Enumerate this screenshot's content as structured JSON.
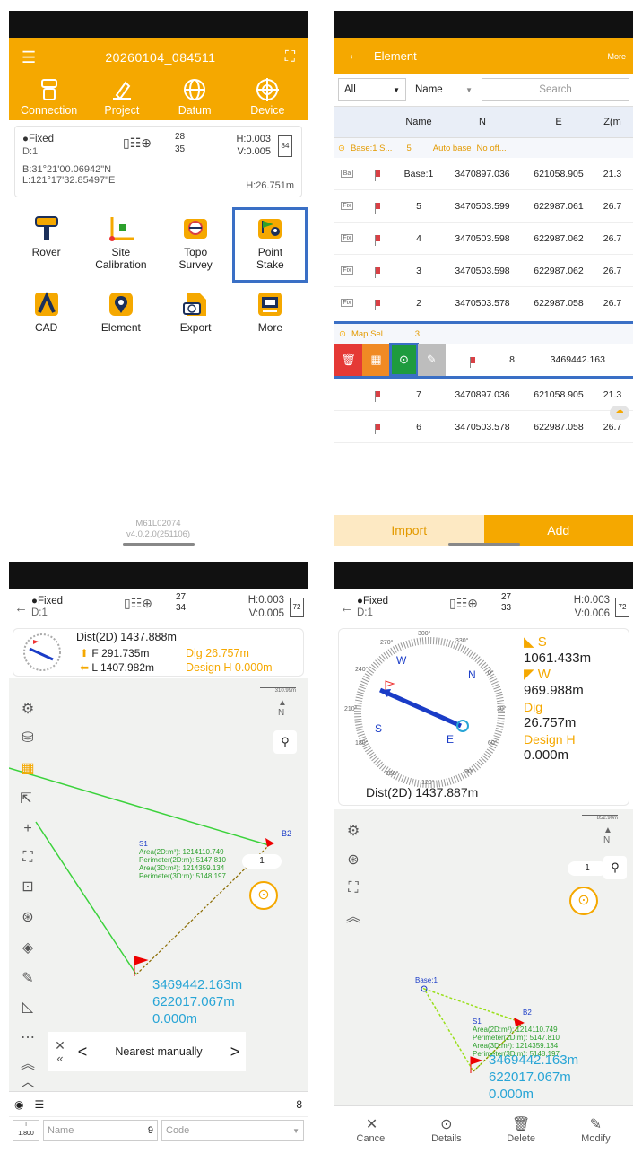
{
  "p1": {
    "title": "20260104_084511",
    "tabs": [
      "Connection",
      "Project",
      "Datum",
      "Device"
    ],
    "status": {
      "fix": "●Fixed",
      "d": "D:1",
      "sat_top": "28",
      "sat_bot": "35",
      "h": "H:0.003",
      "v": "V:0.005",
      "battery": "84",
      "b": "B:31°21'00.06942\"N",
      "l": "L:121°17'32.85497\"E",
      "height": "H:26.751m"
    },
    "tiles": [
      {
        "label": "Rover",
        "icon": "rover-icon"
      },
      {
        "label": "Site\nCalibration",
        "icon": "site-calibration-icon"
      },
      {
        "label": "Topo\nSurvey",
        "icon": "topo-survey-icon"
      },
      {
        "label": "Point\nStake",
        "icon": "point-stake-icon"
      },
      {
        "label": "CAD",
        "icon": "cad-icon"
      },
      {
        "label": "Element",
        "icon": "element-icon"
      },
      {
        "label": "Export",
        "icon": "export-icon"
      },
      {
        "label": "More",
        "icon": "more-icon"
      }
    ],
    "version1": "M61L02074",
    "version2": "v4.0.2.0(251106)"
  },
  "p2": {
    "title": "Element",
    "more": "More",
    "filter_all": "All",
    "filter_name": "Name",
    "search_placeholder": "Search",
    "headers": [
      "Name",
      "N",
      "E",
      "Z(m"
    ],
    "group1": {
      "label": "Base:1 S...",
      "count": "5",
      "auto": "Auto base",
      "extra": "No off..."
    },
    "rows1": [
      {
        "type": "Ba",
        "name": "Base:1",
        "n": "3470897.036",
        "e": "621058.905",
        "z": "21.3"
      },
      {
        "type": "Fix",
        "name": "5",
        "n": "3470503.599",
        "e": "622987.061",
        "z": "26.7"
      },
      {
        "type": "Fix",
        "name": "4",
        "n": "3470503.598",
        "e": "622987.062",
        "z": "26.7"
      },
      {
        "type": "Fix",
        "name": "3",
        "n": "3470503.598",
        "e": "622987.062",
        "z": "26.7"
      },
      {
        "type": "Fix",
        "name": "2",
        "n": "3470503.578",
        "e": "622987.058",
        "z": "26.7"
      }
    ],
    "group2": {
      "label": "Map Sel...",
      "count": "3"
    },
    "swiped_row": {
      "name": "8",
      "n": "3469442.163"
    },
    "rows2": [
      {
        "name": "7",
        "n": "3470897.036",
        "e": "621058.905",
        "z": "21.3"
      },
      {
        "name": "6",
        "n": "3470503.578",
        "e": "622987.058",
        "z": "26.7"
      }
    ],
    "import": "Import",
    "add": "Add"
  },
  "p3": {
    "fix": "●Fixed",
    "d": "D:1",
    "sat_top": "27",
    "sat_bot": "34",
    "h": "H:0.003",
    "v": "V:0.005",
    "battery": "72",
    "dist": "Dist(2D) 1437.888m",
    "f": "F 291.735m",
    "l": "L 1407.982m",
    "dig": "Dig 26.757m",
    "design": "Design H 0.000m",
    "scale": "310.99m",
    "s1": "S1",
    "area2d": "Area(2D:m²): 1214110.749",
    "perim2d": "Perimeter(2D:m): 5147.810",
    "area3d": "Area(3D:m²): 1214359.134",
    "perim3d": "Perimeter(3D:m): 5148.197",
    "page": "1",
    "b2": "B2",
    "coord_n": "3469442.163m",
    "coord_e": "622017.067m",
    "coord_z": "0.000m",
    "nearest": "Nearest manually",
    "count": "8",
    "ant": "1.800",
    "name_ph": "Name",
    "name_val": "9",
    "code_ph": "Code"
  },
  "p4": {
    "fix": "●Fixed",
    "d": "D:1",
    "sat_top": "27",
    "sat_bot": "33",
    "h": "H:0.003",
    "v": "V:0.006",
    "battery": "72",
    "dir1": "S",
    "dist1": "1061.433m",
    "dir2": "W",
    "dist2": "969.988m",
    "dig": "Dig",
    "dig_val": "26.757m",
    "design": "Design H",
    "design_val": "0.000m",
    "dist": "Dist(2D) 1437.887m",
    "compass_labels": [
      "300°",
      "330°",
      "270°",
      "240°",
      "210°",
      "180°",
      "150°",
      "120°",
      "90°",
      "60°",
      "30°",
      "0°",
      "W",
      "N",
      "S",
      "E"
    ],
    "scale": "852.90m",
    "page": "1",
    "base": "Base:1",
    "s1": "S1",
    "b2": "B2",
    "area2d": "Area(2D:m²): 1214110.749",
    "perim2d": "Perimeter(2D:m): 5147.810",
    "area3d": "Area(3D:m²): 1214359.134",
    "perim3d": "Perimeter(3D:m): 5148.197",
    "coord_n": "3469442.163m",
    "coord_e": "622017.067m",
    "coord_z": "0.000m",
    "actions": [
      "Cancel",
      "Details",
      "Delete",
      "Modify"
    ]
  },
  "colors": {
    "accent": "#f5a800",
    "highlight": "#3a6fc5",
    "cyan": "#28a5d6",
    "green": "#2ca02c"
  }
}
